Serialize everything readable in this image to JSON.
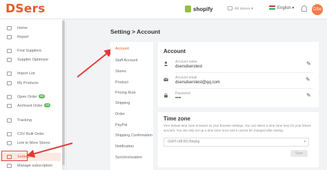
{
  "topbar": {
    "logo": "DSers",
    "platform": "shopify",
    "stores": "All stores",
    "language": "English",
    "avatar": "DSe"
  },
  "sidebar": {
    "items": [
      {
        "label": "Home",
        "icon": "home-icon"
      },
      {
        "label": "Report",
        "icon": "report-icon"
      },
      {
        "label": "Find Suppliers",
        "icon": "find-suppliers-icon"
      },
      {
        "label": "Supplier Optimizer",
        "icon": "optimizer-icon"
      },
      {
        "label": "Import List",
        "icon": "import-list-icon"
      },
      {
        "label": "My Products",
        "icon": "products-icon"
      },
      {
        "label": "Open Order",
        "icon": "open-order-icon",
        "badge": "58"
      },
      {
        "label": "Archived Order",
        "icon": "archived-order-icon",
        "badge": "29"
      },
      {
        "label": "Tracking",
        "icon": "tracking-icon"
      },
      {
        "label": "CSV Bulk Order",
        "icon": "csv-icon"
      },
      {
        "label": "Link to More Stores",
        "icon": "link-icon"
      },
      {
        "label": "Setting",
        "icon": "gear-icon"
      },
      {
        "label": "Manage subscription",
        "icon": "subscription-icon"
      }
    ]
  },
  "page": {
    "title": "Setting > Account"
  },
  "settings_menu": {
    "items": [
      "Account",
      "Staff Account",
      "Stores",
      "Product",
      "Pricing Rule",
      "Shipping",
      "Order",
      "PayPal",
      "Shipping Confirmation",
      "Notification",
      "Synchronization"
    ]
  },
  "account": {
    "title": "Account",
    "name_label": "Account name",
    "name_value": "dsersdserstest",
    "email_label": "Account email",
    "email_value": "dsersdserstest@qq.com",
    "password_label": "Password",
    "password_value": "••••"
  },
  "timezone": {
    "title": "Time zone",
    "description": "Your default time zone is based on your browser settings. You can select a time zone here for your DSers account. You can only set up a time zone once and it cannot be changed after saving.",
    "value": "(GMT+08:00) Beijing",
    "save_label": "Save"
  },
  "colors": {
    "brand": "#e65b2a",
    "highlight": "#e53935"
  }
}
